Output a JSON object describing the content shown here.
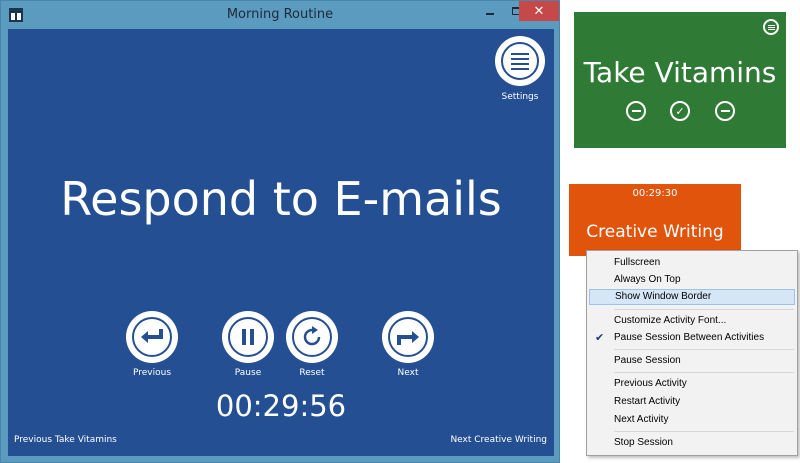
{
  "window": {
    "title": "Morning Routine",
    "close_glyph": "✕"
  },
  "main": {
    "settings_label": "Settings",
    "activity": "Respond to E-mails",
    "controls": {
      "previous": "Previous",
      "pause": "Pause",
      "reset": "Reset",
      "next": "Next"
    },
    "timer": "00:29:56",
    "footer_prev": "Previous Take Vitamins",
    "footer_next": "Next Creative Writing"
  },
  "green_widget": {
    "title": "Take Vitamins",
    "check_glyph": "✓",
    "color": "#2f7a35"
  },
  "orange_widget": {
    "timer": "00:29:30",
    "title": "Creative Writing",
    "color": "#e0540c"
  },
  "context_menu": {
    "items": [
      {
        "label": "Fullscreen"
      },
      {
        "label": "Always On Top"
      },
      {
        "label": "Show Window Border",
        "highlighted": true
      },
      {
        "label": "Customize Activity Font..."
      },
      {
        "label": "Pause Session Between Activities",
        "checked": true
      },
      {
        "label": "Pause Session"
      },
      {
        "label": "Previous Activity"
      },
      {
        "label": "Restart Activity"
      },
      {
        "label": "Next Activity"
      },
      {
        "label": "Stop Session"
      }
    ],
    "check_glyph": "✔"
  },
  "colors": {
    "client_bg": "#244f93",
    "titlebar": "#5b9bbf",
    "close_button": "#c74848",
    "menu_highlight": "#d5e6f7"
  }
}
